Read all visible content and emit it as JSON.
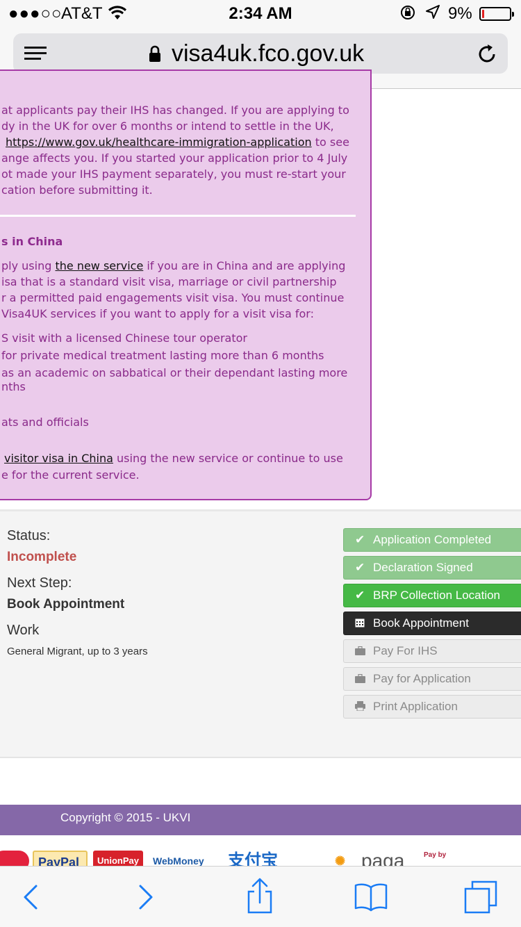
{
  "status_bar": {
    "signal": "●●●○○",
    "carrier": "AT&T",
    "time": "2:34 AM",
    "battery_pct": "9%",
    "battery_level": 0.09
  },
  "browser": {
    "url": "visa4uk.fco.gov.uk"
  },
  "notice": {
    "ihs_lines": [
      "at applicants pay their IHS has changed. If you are applying to",
      "dy in the UK for over 6 months or intend to settle in the UK,",
      "to see",
      "ange affects you. If you started your application prior to 4 July",
      "ot made your IHS payment separately, you must re-start your",
      "cation before submitting it."
    ],
    "ihs_link": "https://www.gov.uk/healthcare-immigration-application",
    "china_heading": "s in China",
    "china_pre": "ply using",
    "china_link": "the new service",
    "china_post": "if you are in China and are applying",
    "china_lines": [
      "isa that is a standard visit visa, marriage or civil partnership",
      "r a permitted paid engagements visit visa. You must continue",
      "Visa4UK services if you want to apply for a visit visa for:"
    ],
    "china_bullets": [
      "S visit with a licensed Chinese tour operator",
      "for private medical treatment lasting more than 6 months",
      "as an academic on sabbatical or their dependant lasting more",
      "nths",
      "ats and officials"
    ],
    "visitor_link": "visitor visa in China",
    "visitor_post": "using the new service or continue to use",
    "last_line": "e for the current service."
  },
  "status": {
    "status_label": "Status:",
    "status_value": "Incomplete",
    "next_label": "Next Step:",
    "next_value": "Book Appointment",
    "category_label": "Work",
    "category_value": "General Migrant, up to 3 years"
  },
  "steps": [
    {
      "label": "Application Completed",
      "state": "done",
      "icon": "check-icon"
    },
    {
      "label": "Declaration Signed",
      "state": "done",
      "icon": "check-icon"
    },
    {
      "label": "BRP Collection Location",
      "state": "done-strong",
      "icon": "check-icon"
    },
    {
      "label": "Book Appointment",
      "state": "active",
      "icon": "calendar-icon"
    },
    {
      "label": "Pay For IHS",
      "state": "pending",
      "icon": "briefcase-icon"
    },
    {
      "label": "Pay for Application",
      "state": "pending",
      "icon": "briefcase-icon"
    },
    {
      "label": "Print Application",
      "state": "pending",
      "icon": "printer-icon"
    }
  ],
  "footer": {
    "copyright": "Copyright © 2015 - UKVI"
  },
  "payment_logos": [
    "PayPal",
    "UnionPay",
    "WebMoney",
    "支付宝",
    "paga",
    "Pay by"
  ],
  "colors": {
    "notice_bg": "#ebcbeb",
    "notice_text": "#8a2a8a",
    "incomplete": "#c0504d",
    "step_done": "#8fc98f",
    "step_done_strong": "#46b946",
    "step_active": "#2b2b2b",
    "footer": "#8568a8",
    "ios_blue": "#1a7cf5"
  }
}
